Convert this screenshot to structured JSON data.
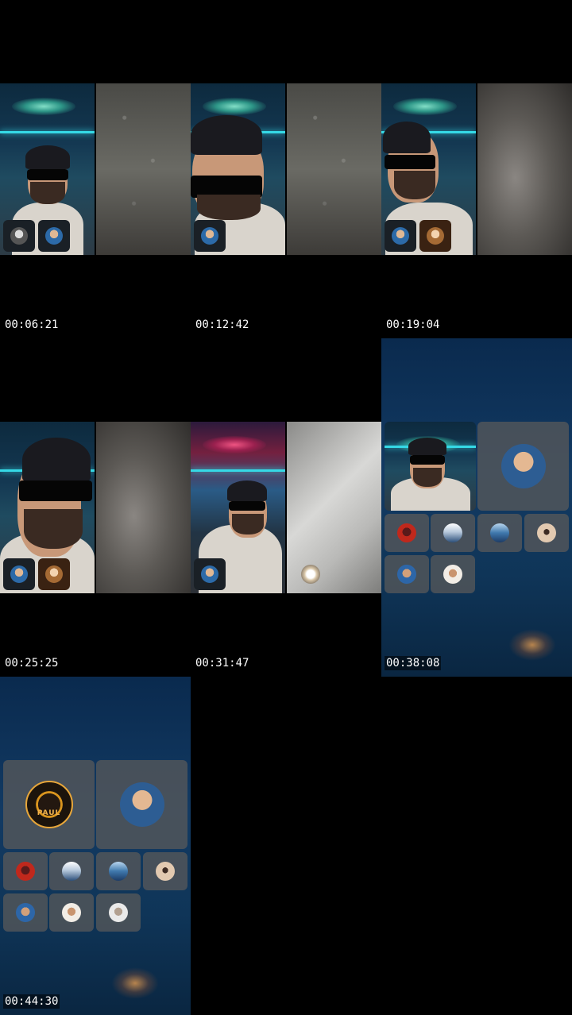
{
  "timestamps": [
    "00:06:21",
    "00:12:42",
    "00:19:04",
    "00:25:25",
    "00:31:47",
    "00:38:08",
    "00:44:30"
  ],
  "gallery_logo_text": "PAUL",
  "colors": {
    "background": "#000000",
    "neon": "#35d9e6",
    "ocean": "#123a63",
    "tile": "#5a5a5a"
  }
}
